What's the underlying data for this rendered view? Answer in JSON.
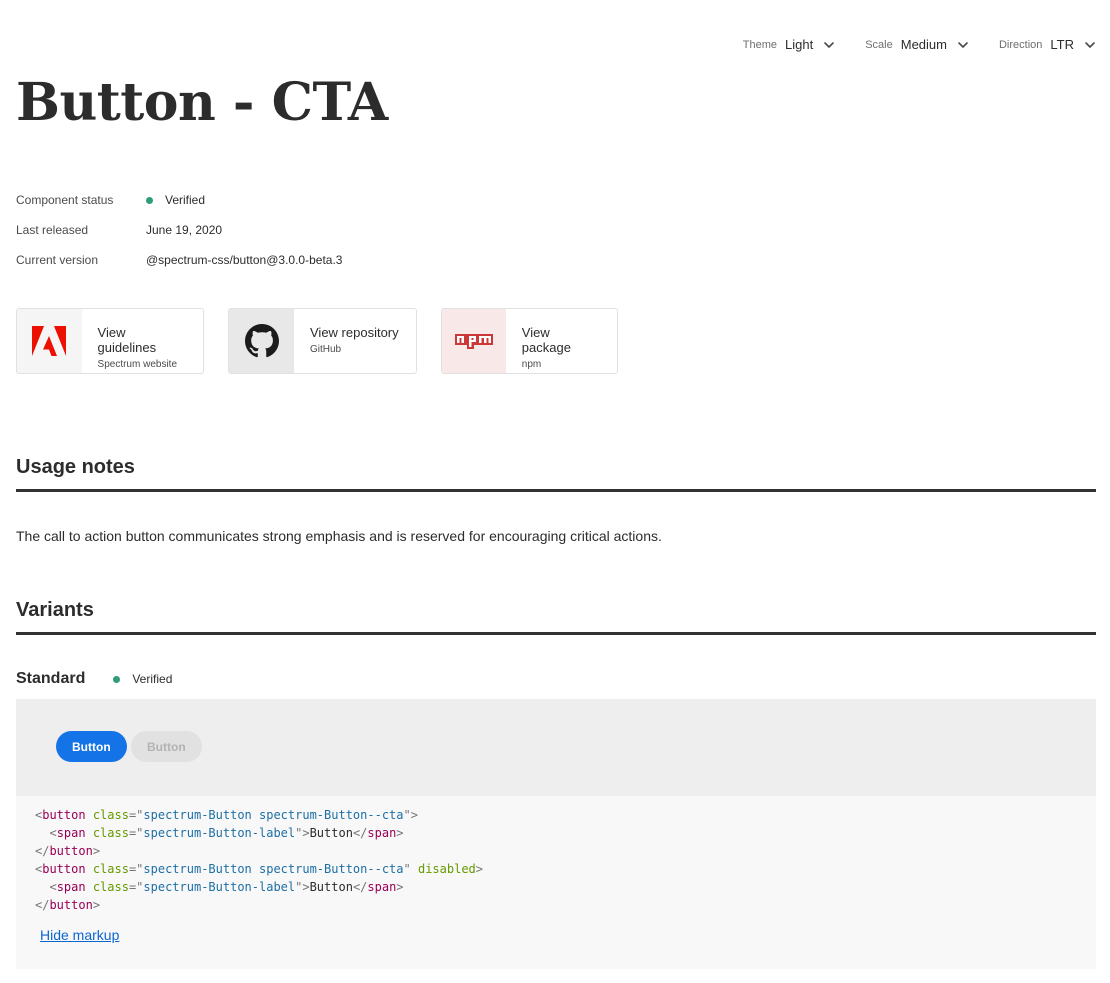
{
  "toolbar": {
    "theme": {
      "label": "Theme",
      "value": "Light"
    },
    "scale": {
      "label": "Scale",
      "value": "Medium"
    },
    "direction": {
      "label": "Direction",
      "value": "LTR"
    }
  },
  "page": {
    "title": "Button - CTA"
  },
  "meta": [
    {
      "key": "Component status",
      "value": "Verified"
    },
    {
      "key": "Last released",
      "value": "June 19, 2020"
    },
    {
      "key": "Current version",
      "value": "@spectrum-css/button@3.0.0-beta.3"
    }
  ],
  "resources": [
    {
      "title": "View guidelines",
      "subtitle": "Spectrum website",
      "icon": "adobe-logo-icon",
      "icon_bg": "#f5f5f5",
      "icon_color": "#eb1000"
    },
    {
      "title": "View repository",
      "subtitle": "GitHub",
      "icon": "github-icon",
      "icon_bg": "#e8e8e8",
      "icon_color": "#1b1b1b"
    },
    {
      "title": "View package",
      "subtitle": "npm",
      "icon": "npm-icon",
      "icon_bg": "#f9e8e8",
      "icon_color": "#cb3837"
    }
  ],
  "usage": {
    "heading": "Usage notes",
    "text": "The call to action button communicates strong emphasis and is reserved for encouraging critical actions."
  },
  "variants": {
    "heading": "Variants",
    "items": [
      {
        "name": "Standard",
        "status": "Verified",
        "buttons": [
          {
            "label": "Button",
            "disabled": false
          },
          {
            "label": "Button",
            "disabled": true
          }
        ],
        "markup": {
          "tag_button": "button",
          "tag_span": "span",
          "attr_class": "class",
          "attr_disabled": "disabled",
          "class_button": "spectrum-Button spectrum-Button--cta",
          "class_label": "spectrum-Button-label",
          "label_text": "Button"
        },
        "hide_markup": "Hide markup"
      }
    ]
  },
  "colors": {
    "accent": "#1473e6",
    "status_verified": "#2d9d78",
    "link": "#0d66d0"
  }
}
